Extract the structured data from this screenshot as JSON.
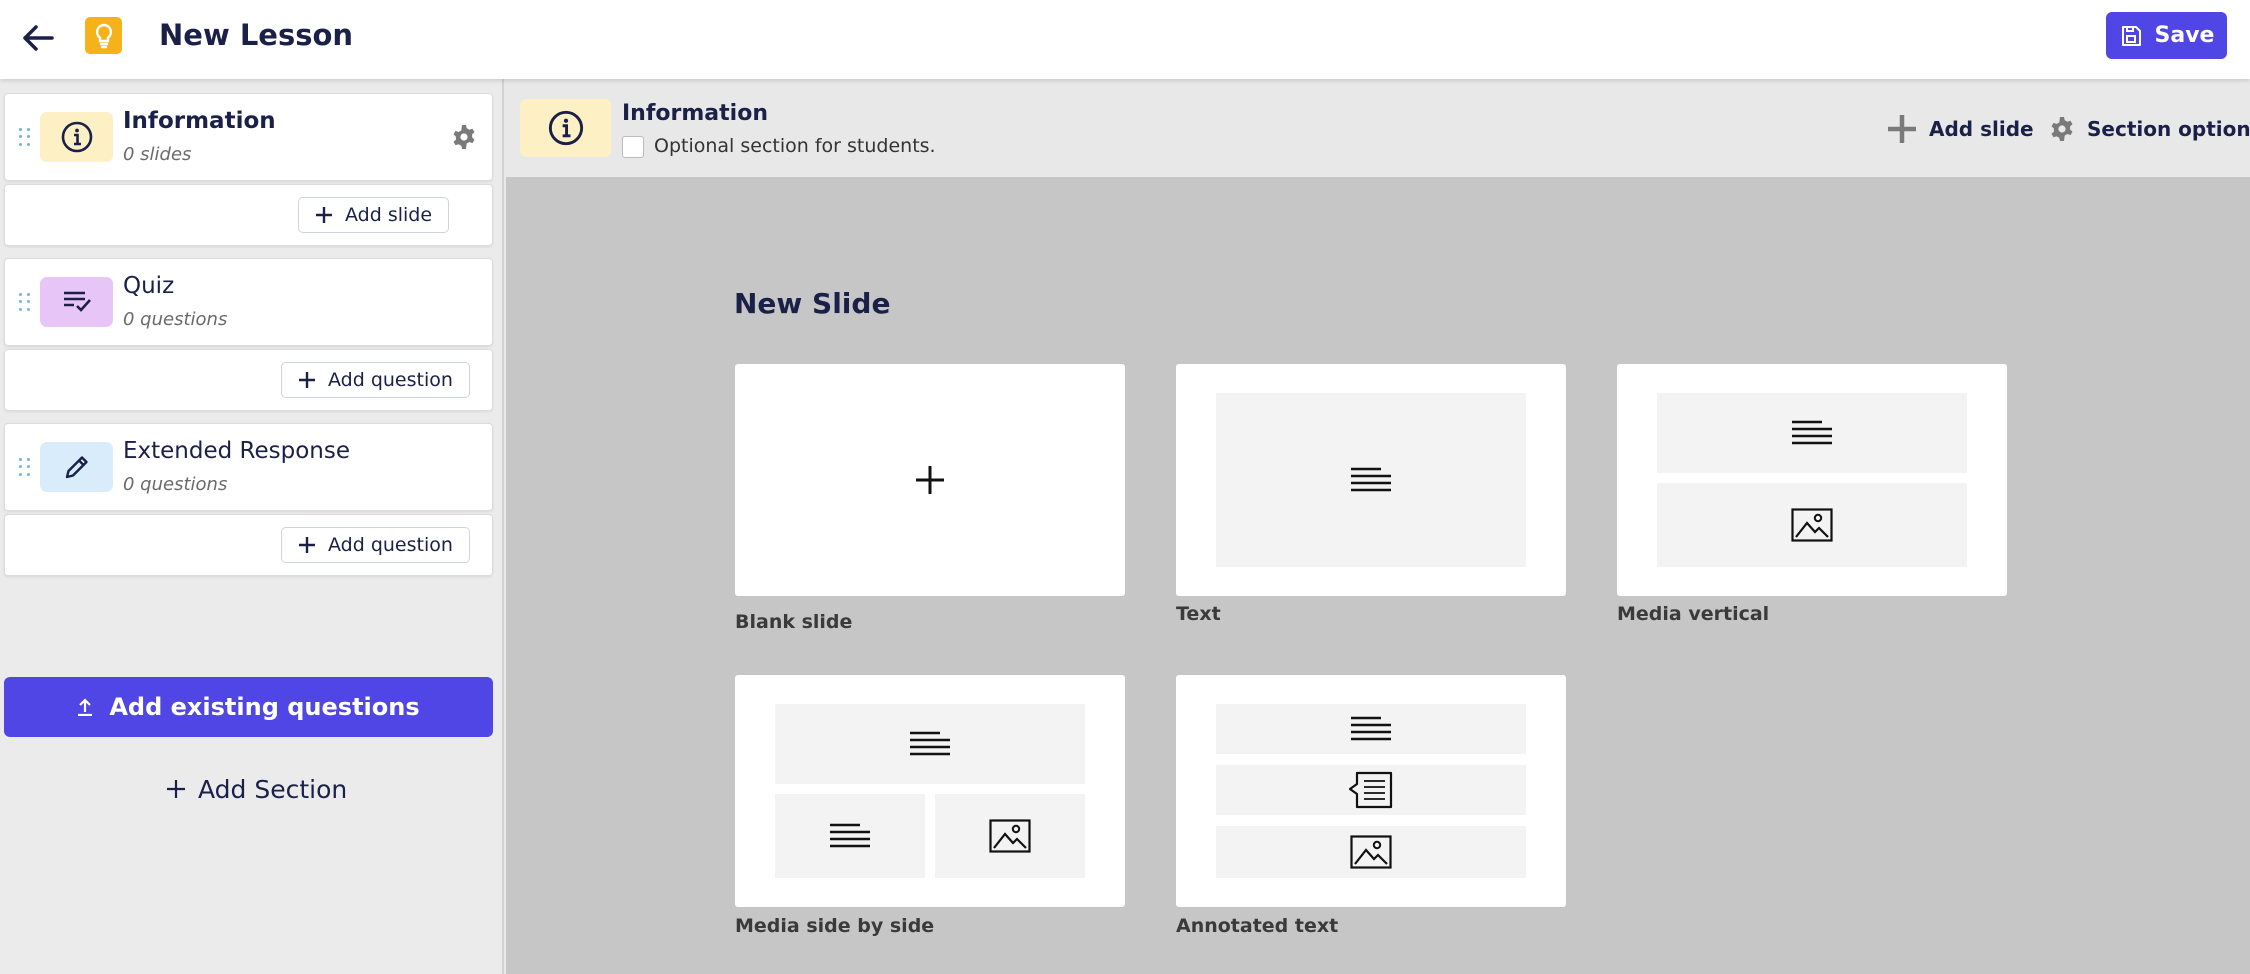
{
  "header": {
    "title": "New Lesson",
    "back_icon": "arrow-left-icon",
    "logo_icon": "lightbulb-icon",
    "save_label": "Save",
    "save_icon": "save-icon",
    "brand_color": "#4f46e5",
    "logo_color": "#f6b21b"
  },
  "sidebar": {
    "sections": [
      {
        "title": "Information",
        "subtitle": "0 slides",
        "icon": "info-icon",
        "icon_bg": "#fdf0c4",
        "add_label": "Add slide"
      },
      {
        "title": "Quiz",
        "subtitle": "0 questions",
        "icon": "checklist-icon",
        "icon_bg": "#e8c5f7",
        "add_label": "Add question"
      },
      {
        "title": "Extended Response",
        "subtitle": "0 questions",
        "icon": "pencil-icon",
        "icon_bg": "#d9ecfb",
        "add_label": "Add question"
      }
    ],
    "add_existing_label": "Add existing questions",
    "add_section_label": "Add Section"
  },
  "main": {
    "section_title": "Information",
    "optional_label": "Optional section for students.",
    "add_slide_label": "Add slide",
    "section_options_label": "Section options"
  },
  "canvas": {
    "title": "New Slide",
    "templates": [
      {
        "label": "Blank slide"
      },
      {
        "label": "Text"
      },
      {
        "label": "Media vertical"
      },
      {
        "label": "Media side by side"
      },
      {
        "label": "Annotated text"
      }
    ]
  }
}
